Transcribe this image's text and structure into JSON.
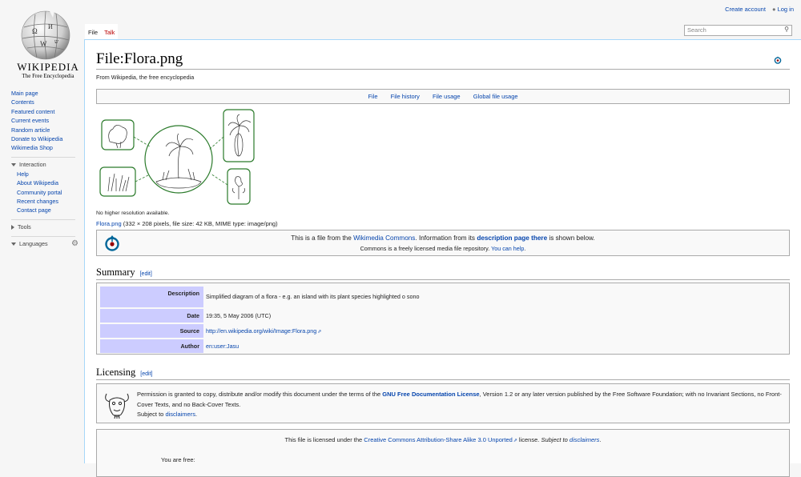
{
  "logo": {
    "wordmark": "WIKIPEDIA",
    "tagline": "The Free Encyclopedia"
  },
  "sidebar": {
    "navigation": [
      "Main page",
      "Contents",
      "Featured content",
      "Current events",
      "Random article",
      "Donate to Wikipedia",
      "Wikimedia Shop"
    ],
    "interaction_label": "Interaction",
    "interaction": [
      "Help",
      "About Wikipedia",
      "Community portal",
      "Recent changes",
      "Contact page"
    ],
    "tools_label": "Tools",
    "languages_label": "Languages"
  },
  "personal": {
    "create_account": "Create account",
    "log_in": "Log in"
  },
  "tabs": {
    "file": "File",
    "talk": "Talk"
  },
  "search": {
    "placeholder": "Search"
  },
  "page": {
    "title": "File:Flora.png",
    "from": "From Wikipedia, the free encyclopedia",
    "toc": [
      "File",
      "File history",
      "File usage",
      "Global file usage"
    ],
    "no_higher": "No higher resolution available.",
    "file_link": "Flora.png",
    "file_meta": " (332 × 208 pixels, file size: 42 KB, MIME type: image/png)"
  },
  "commons": {
    "l1_a": "This is a file from the ",
    "l1_link1": "Wikimedia Commons",
    "l1_b": ". Information from its ",
    "l1_link2": "description page there",
    "l1_c": " is shown below.",
    "l2_a": "Commons is a freely licensed media file repository. ",
    "l2_link": "You can help",
    "l2_b": "."
  },
  "summary": {
    "heading": "Summary",
    "edit": "[edit]",
    "rows": [
      {
        "key": "Description",
        "value": "Simplified diagram of a flora - e.g. an island with its plant species highlighted o sono"
      },
      {
        "key": "Date",
        "value": "19:35, 5 May 2006 (UTC)"
      },
      {
        "key": "Source",
        "value": "http://en.wikipedia.org/wiki/Image:Flora.png"
      },
      {
        "key": "Author",
        "value": "en:user:Jasu"
      }
    ]
  },
  "licensing": {
    "heading": "Licensing",
    "edit": "[edit]",
    "gfdl_a": "Permission is granted to copy, distribute and/or modify this document under the terms of the ",
    "gfdl_link": "GNU Free Documentation License",
    "gfdl_b": ", Version 1.2 or any later version published by the Free Software Foundation; with no Invariant Sections, no Front-Cover Texts, and no Back-Cover Texts.",
    "subject_a": "Subject to ",
    "subject_link": "disclaimers",
    "subject_b": ".",
    "cc_a": "This file is licensed under the ",
    "cc_link": "Creative Commons Attribution-Share Alike 3.0 Unported",
    "cc_b": " license. ",
    "cc_c": "Subject to ",
    "cc_link2": "disclaimers",
    "cc_d": ".",
    "you_are_free": "You are free:"
  }
}
